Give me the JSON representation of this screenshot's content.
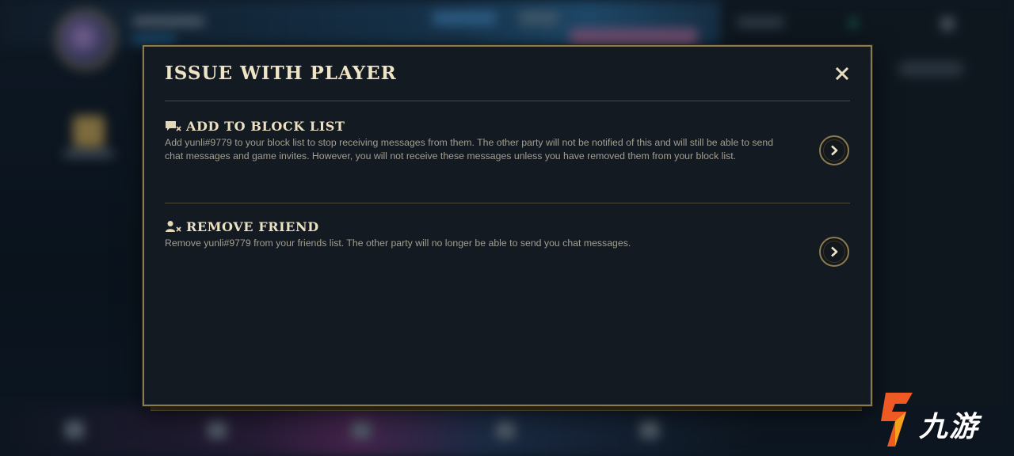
{
  "modal": {
    "title": "ISSUE WITH PLAYER",
    "options": [
      {
        "icon": "block-chat-icon",
        "title": "ADD TO BLOCK LIST",
        "description": "Add yunli#9779 to your block list to stop receiving messages from them. The other party will not be notified of this and will still be able to send chat messages and game invites. However, you will not receive these messages unless you have removed them from your block list."
      },
      {
        "icon": "remove-friend-icon",
        "title": "REMOVE FRIEND",
        "description": "Remove yunli#9779 from your friends list. The other party will no longer be able to send you chat messages."
      }
    ]
  },
  "watermark": {
    "text": "九游"
  },
  "colors": {
    "gold_border": "#8b7a4f",
    "title_text": "#efe4c6",
    "body_text": "#a29f91",
    "modal_bg": "#141a21"
  }
}
